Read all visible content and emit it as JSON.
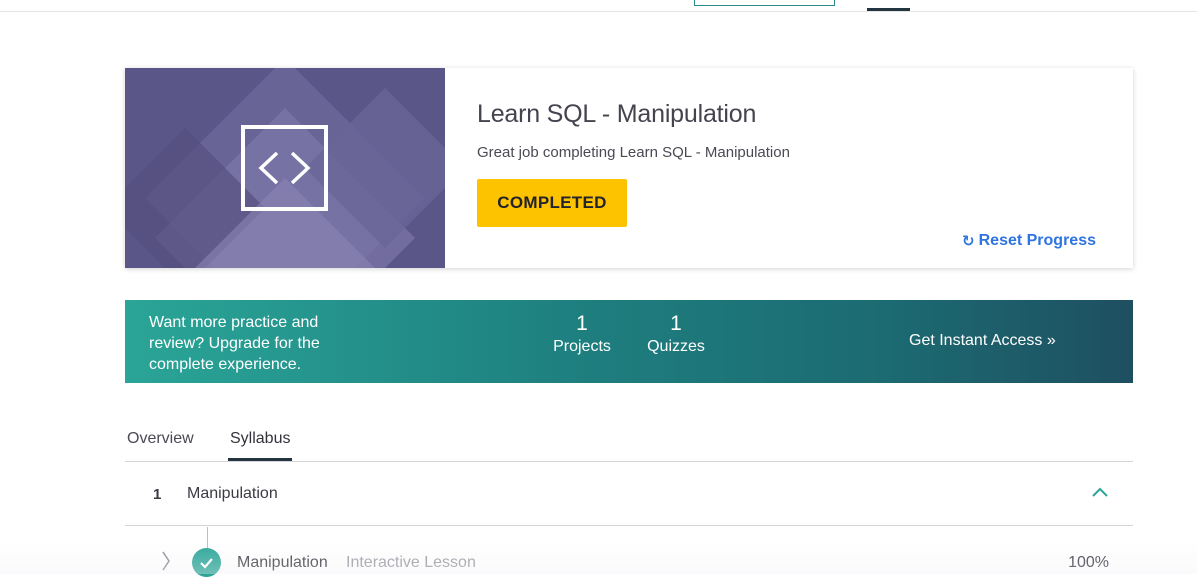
{
  "course": {
    "title": "Learn SQL - Manipulation",
    "subtitle": "Great job completing Learn SQL - Manipulation",
    "status_label": "COMPLETED",
    "reset_label": "Reset Progress",
    "banner_icon": "code-brackets-icon"
  },
  "upgrade": {
    "message": "Want more practice and review? Upgrade for the complete experience.",
    "projects_count": "1",
    "projects_label": "Projects",
    "quizzes_count": "1",
    "quizzes_label": "Quizzes",
    "cta_label": "Get Instant Access »"
  },
  "tabs": [
    {
      "label": "Overview",
      "active": false
    },
    {
      "label": "Syllabus",
      "active": true
    }
  ],
  "syllabus": {
    "modules": [
      {
        "number": "1",
        "title": "Manipulation",
        "expanded": true,
        "lessons": [
          {
            "name": "Manipulation",
            "type": "Interactive Lesson",
            "progress": "100%",
            "completed": true
          }
        ]
      }
    ]
  },
  "colors": {
    "accent_yellow": "#fdc200",
    "link_blue": "#2f74e0",
    "teal": "#2aa597",
    "banner_purple": "#6b6496"
  }
}
